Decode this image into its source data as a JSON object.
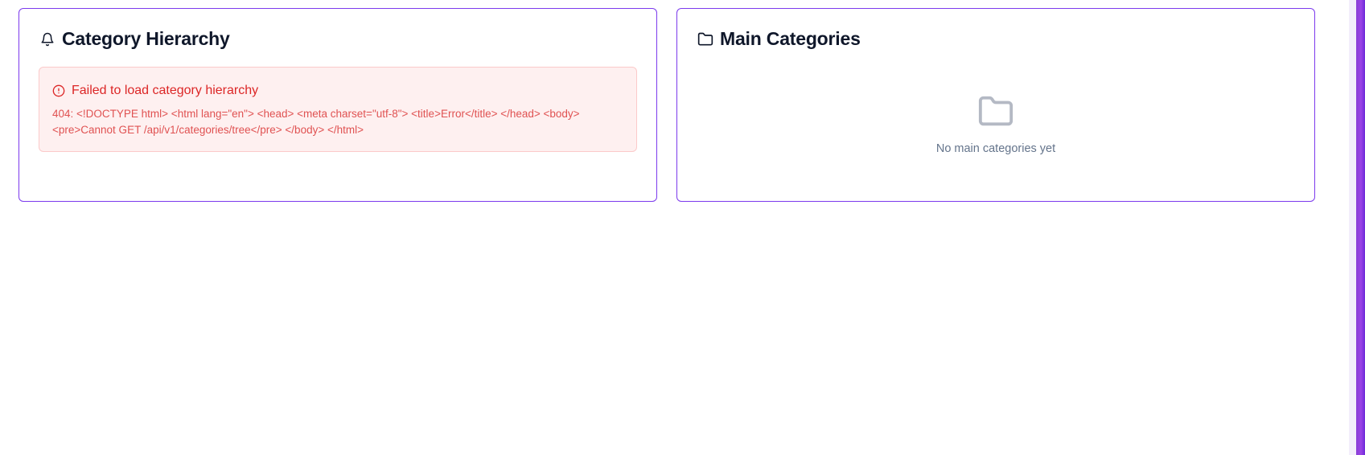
{
  "category_hierarchy": {
    "title": "Category Hierarchy",
    "header_icon": "bell-icon",
    "error": {
      "icon": "alert-circle-icon",
      "title": "Failed to load category hierarchy",
      "message": "404: <!DOCTYPE html> <html lang=\"en\"> <head> <meta charset=\"utf-8\"> <title>Error</title> </head> <body> <pre>Cannot GET /api/v1/categories/tree</pre> </body> </html>"
    }
  },
  "main_categories": {
    "title": "Main Categories",
    "header_icon": "folder-icon",
    "empty_state": {
      "icon": "folder-icon",
      "text": "No main categories yet"
    }
  },
  "colors": {
    "card_border": "#7c3aed",
    "error_text": "#dc2626",
    "error_background": "#fef0f0",
    "muted_text": "#64748b",
    "accent_bar": "#8b3fd6"
  }
}
